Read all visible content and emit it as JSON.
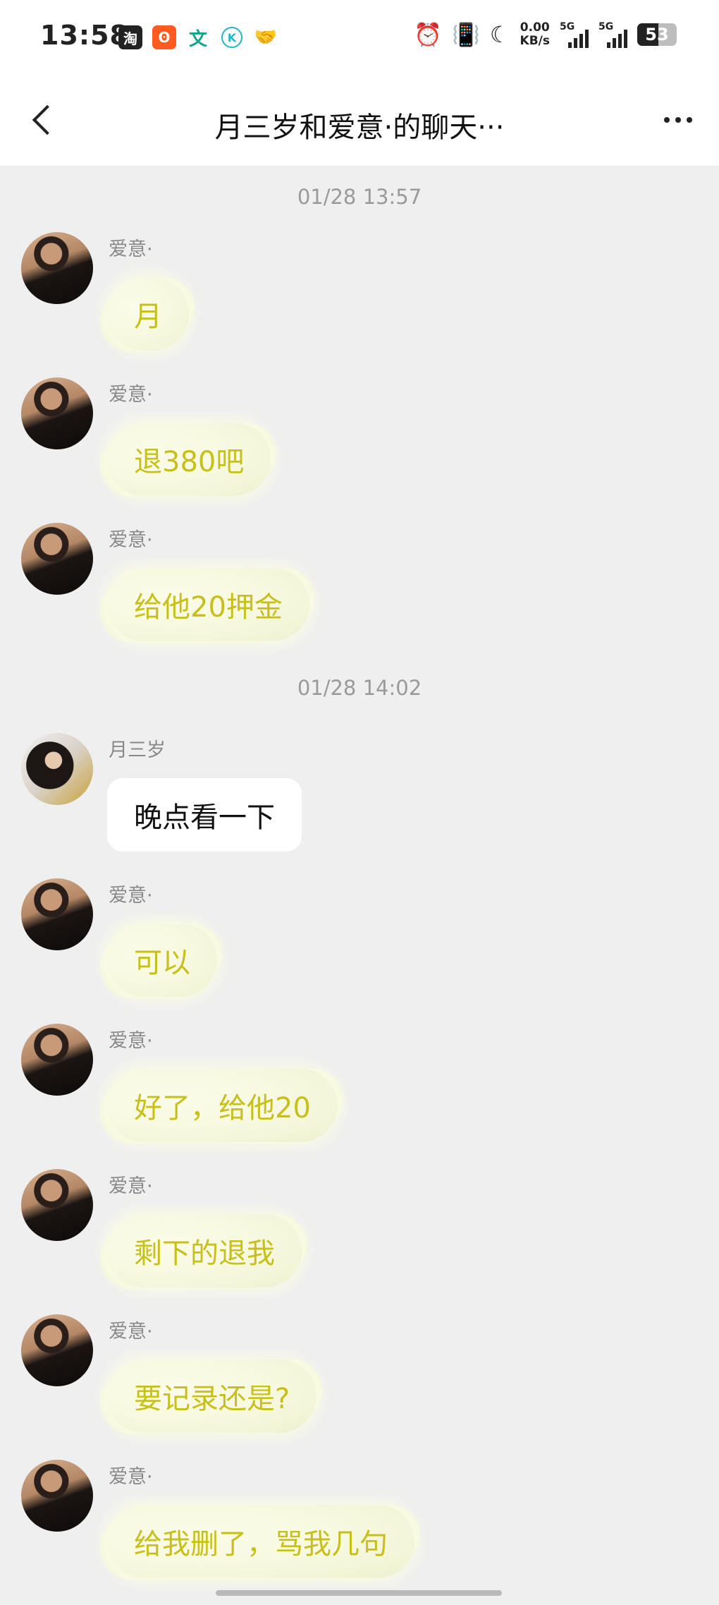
{
  "status_bar": {
    "time": "13:58",
    "app_icons": [
      {
        "name": "taobao-icon",
        "glyph": "淘"
      },
      {
        "name": "kuaishou-icon",
        "glyph": "ʘ"
      },
      {
        "name": "wen-icon",
        "glyph": "文"
      },
      {
        "name": "k-app-icon",
        "glyph": "K"
      },
      {
        "name": "handshake-icon",
        "glyph": "🤝"
      }
    ],
    "net_speed_value": "0.00",
    "net_speed_unit": "KB/s",
    "signal1_label": "5G",
    "signal2_label": "5G",
    "battery": "53",
    "battery_level": 0.53
  },
  "header": {
    "title": "月三岁和爱意·的聊天···"
  },
  "chat": {
    "timestamps": [
      "01/28 13:57",
      "01/28 14:02"
    ],
    "messages": [
      {
        "sender": "爱意·",
        "text": "月"
      },
      {
        "sender": "爱意·",
        "text": "退380吧"
      },
      {
        "sender": "爱意·",
        "text": "给他20押金"
      },
      {
        "sender": "月三岁",
        "text": "晚点看一下"
      },
      {
        "sender": "爱意·",
        "text": "可以"
      },
      {
        "sender": "爱意·",
        "text": "好了，给他20"
      },
      {
        "sender": "爱意·",
        "text": "剩下的退我"
      },
      {
        "sender": "爱意·",
        "text": "要记录还是?"
      },
      {
        "sender": "爱意·",
        "text": "给我删了，骂我几句"
      }
    ]
  }
}
